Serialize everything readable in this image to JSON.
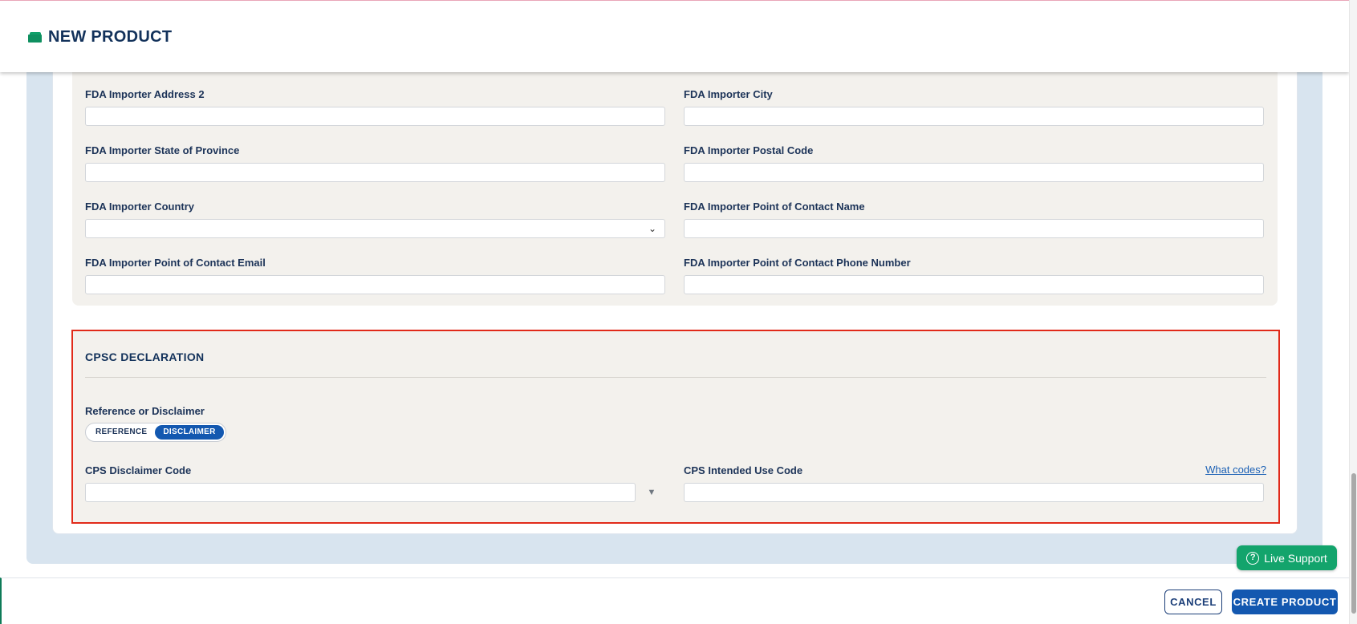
{
  "header": {
    "title": "NEW PRODUCT",
    "icon": "folder-icon"
  },
  "fda_fields": [
    {
      "name": "fda-importer-address-2",
      "label": "FDA Importer Address 2",
      "type": "text",
      "value": ""
    },
    {
      "name": "fda-importer-city",
      "label": "FDA Importer City",
      "type": "text",
      "value": ""
    },
    {
      "name": "fda-importer-state-of-province",
      "label": "FDA Importer State of Province",
      "type": "text",
      "value": ""
    },
    {
      "name": "fda-importer-postal-code",
      "label": "FDA Importer Postal Code",
      "type": "text",
      "value": ""
    },
    {
      "name": "fda-importer-country",
      "label": "FDA Importer Country",
      "type": "select",
      "value": ""
    },
    {
      "name": "fda-importer-poc-name",
      "label": "FDA Importer Point of Contact Name",
      "type": "text",
      "value": ""
    },
    {
      "name": "fda-importer-poc-email",
      "label": "FDA Importer Point of Contact Email",
      "type": "text",
      "value": ""
    },
    {
      "name": "fda-importer-poc-phone",
      "label": "FDA Importer Point of Contact Phone Number",
      "type": "text",
      "value": ""
    }
  ],
  "cpsc": {
    "title": "CPSC DECLARATION",
    "toggle_label": "Reference or Disclaimer",
    "toggle_options": [
      "REFERENCE",
      "DISCLAIMER"
    ],
    "toggle_selected": "DISCLAIMER",
    "disclaimer_code_label": "CPS Disclaimer Code",
    "disclaimer_code_value": "",
    "intended_use_label": "CPS Intended Use Code",
    "intended_use_value": "",
    "help_link": "What codes?"
  },
  "live_support": {
    "label": "Live Support",
    "icon": "help-circle-icon"
  },
  "footer": {
    "cancel_label": "CANCEL",
    "create_label": "CREATE PRODUCT"
  },
  "colors": {
    "accent": "#1358b0",
    "brand_green": "#13a46c",
    "highlight_border": "#e12a1a",
    "panel_bg": "#f3f1ed"
  }
}
